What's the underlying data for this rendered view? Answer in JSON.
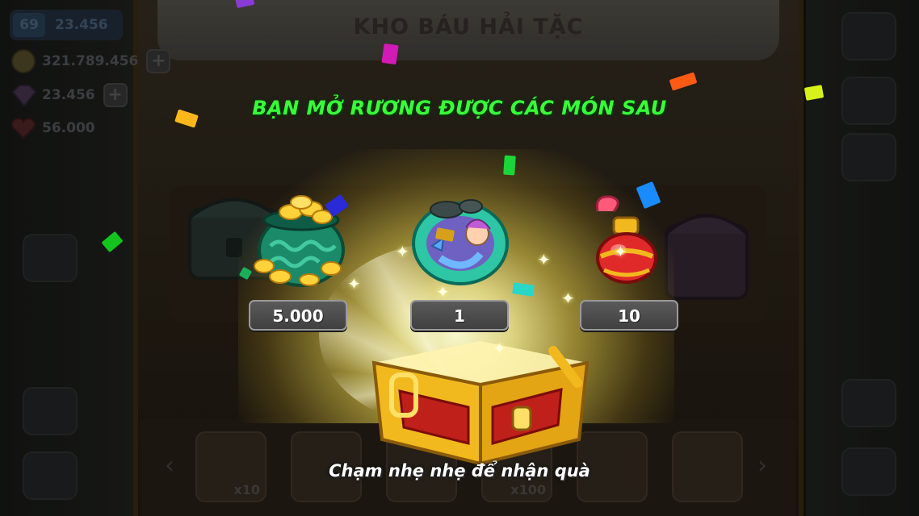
{
  "hud": {
    "level": "69",
    "exp": "23.456",
    "gold": "321.789.456",
    "gems": "23.456",
    "hearts": "56.000",
    "plus_label": "+"
  },
  "panel": {
    "title": "KHO BÁU HẢI TẶC"
  },
  "reward": {
    "heading": "BẠN MỞ RƯƠNG ĐƯỢC CÁC MÓN SAU",
    "items": [
      {
        "icon": "gold-pot-icon",
        "quantity": "5.000"
      },
      {
        "icon": "mermaid-pet-icon",
        "quantity": "1"
      },
      {
        "icon": "red-potion-icon",
        "quantity": "10"
      }
    ],
    "hint": "Chạm nhẹ nhẹ để nhận quà"
  },
  "bottom_slots": {
    "counts": [
      "x10",
      "",
      "",
      "x100",
      "",
      ""
    ],
    "prev_label": "‹",
    "next_label": "›"
  },
  "colors": {
    "heading_green": "#39ff3a",
    "glow_gold": "#ffe066",
    "chest_gold": "#f2b91e",
    "chest_red": "#c0201a"
  }
}
